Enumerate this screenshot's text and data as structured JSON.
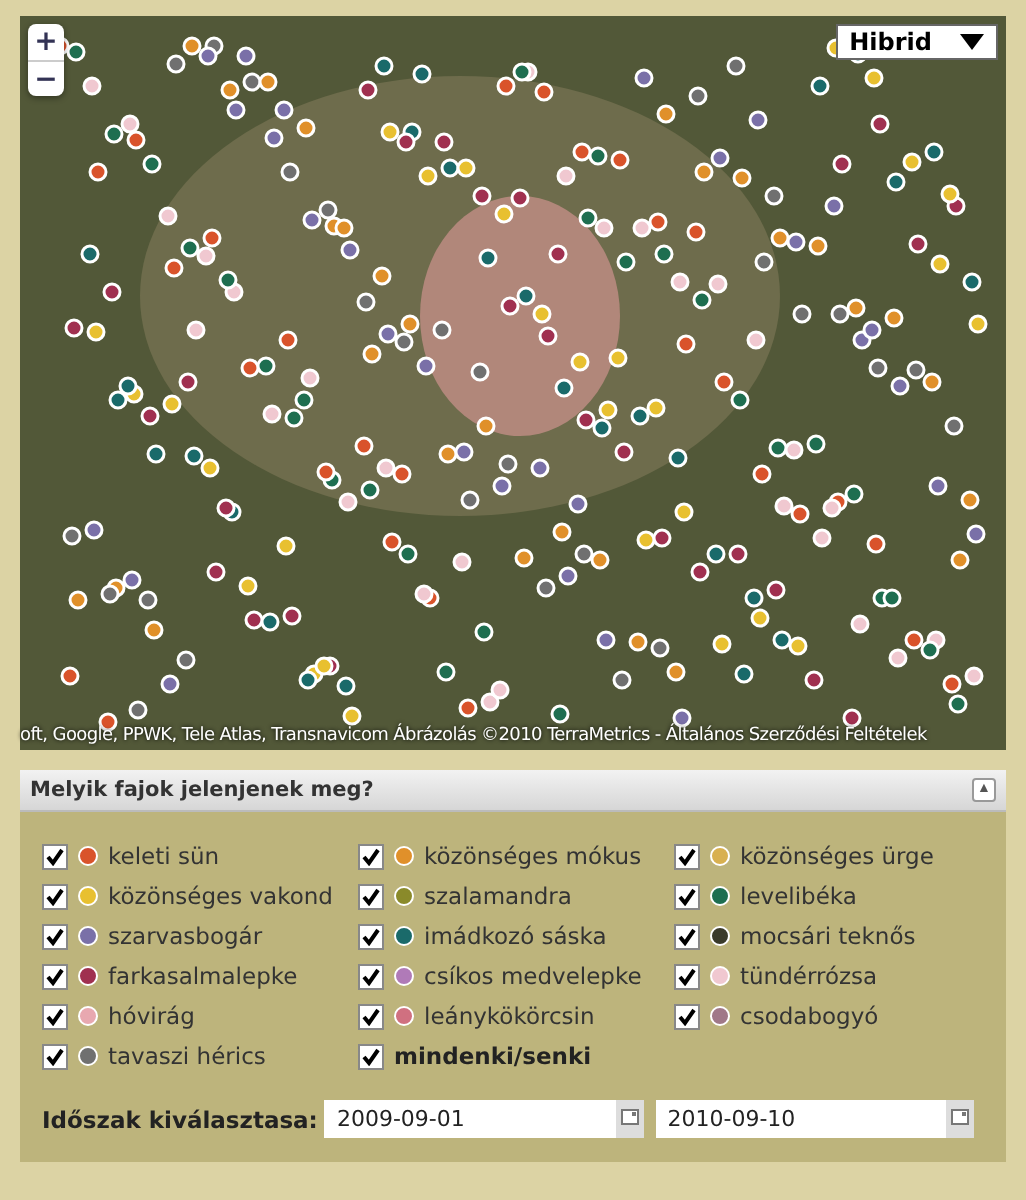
{
  "map": {
    "zoom_in": "+",
    "zoom_out": "−",
    "map_type": "Hibrid",
    "attribution": "oft, Google, PPWK, Tele Atlas, Transnavicom Ábrázolás ©2010 TerraMetrics - Általános Szerződési Feltételek"
  },
  "species_panel": {
    "title": "Melyik fajok jelenjenek meg?",
    "collapse_icon": "▲",
    "items": [
      {
        "kind": "species",
        "label": "keleti sün",
        "checked": true,
        "color": "#d9532b"
      },
      {
        "kind": "species",
        "label": "közönséges mókus",
        "checked": true,
        "color": "#e0902a"
      },
      {
        "kind": "species",
        "label": "közönséges ürge",
        "checked": true,
        "color": "#d8b050"
      },
      {
        "kind": "species",
        "label": "közönséges vakond",
        "checked": true,
        "color": "#e8c030"
      },
      {
        "kind": "species",
        "label": "szalamandra",
        "checked": true,
        "color": "#8a8a2a"
      },
      {
        "kind": "species",
        "label": "levelibéka",
        "checked": true,
        "color": "#1e6e50"
      },
      {
        "kind": "species",
        "label": "szarvasbogár",
        "checked": true,
        "color": "#7a70a8"
      },
      {
        "kind": "species",
        "label": "imádkozó sáska",
        "checked": true,
        "color": "#1a6a6a"
      },
      {
        "kind": "species",
        "label": "mocsári teknős",
        "checked": true,
        "color": "#3a3a2a"
      },
      {
        "kind": "species",
        "label": "farkasalmalepke",
        "checked": true,
        "color": "#a03050"
      },
      {
        "kind": "species",
        "label": "csíkos medvelepke",
        "checked": true,
        "color": "#b07ab8"
      },
      {
        "kind": "species",
        "label": "tündérrózsa",
        "checked": true,
        "color": "#f0c8d0"
      },
      {
        "kind": "species",
        "label": "hóvirág",
        "checked": true,
        "color": "#e8a8b0"
      },
      {
        "kind": "species",
        "label": "leánykökörcsin",
        "checked": true,
        "color": "#d07080"
      },
      {
        "kind": "species",
        "label": "csodabogyó",
        "checked": true,
        "color": "#a07888"
      },
      {
        "kind": "species",
        "label": "tavaszi hérics",
        "checked": true,
        "color": "#707070"
      },
      {
        "kind": "all",
        "label": "mindenki/senki",
        "checked": true
      }
    ],
    "period": {
      "label": "Időszak kiválasztasa:",
      "from": "2009-09-01",
      "to": "2010-09-10"
    }
  }
}
